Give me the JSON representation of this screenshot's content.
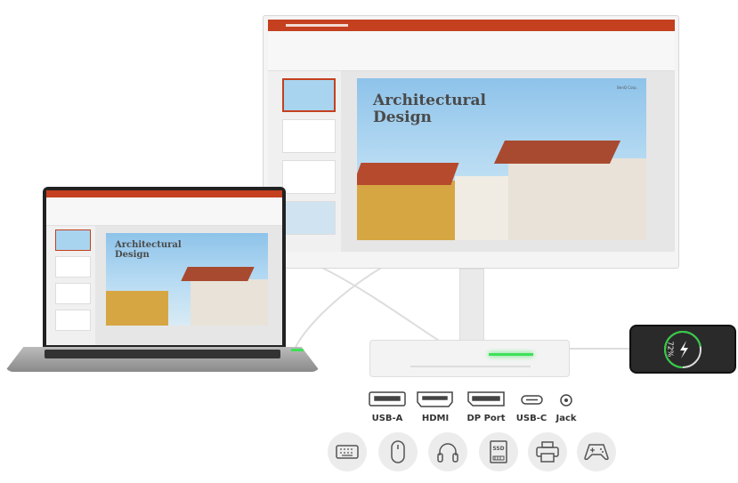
{
  "slide": {
    "title_line1": "Architectural",
    "title_line2": "Design",
    "company": "BenQ Corp."
  },
  "phone": {
    "battery_percent": "72%",
    "battery_level": 0.72,
    "ring_color": "#2ecc40"
  },
  "ports": [
    {
      "label": "USB-A",
      "icon": "usb-a-icon"
    },
    {
      "label": "HDMI",
      "icon": "hdmi-icon"
    },
    {
      "label": "DP Port",
      "icon": "displayport-icon"
    },
    {
      "label": "USB-C",
      "icon": "usb-c-icon"
    },
    {
      "label": "Jack",
      "icon": "audio-jack-icon"
    }
  ],
  "devices": [
    {
      "icon": "keyboard-icon"
    },
    {
      "icon": "mouse-icon"
    },
    {
      "icon": "headphones-icon"
    },
    {
      "icon": "ssd-icon",
      "label": "SSD"
    },
    {
      "icon": "printer-icon"
    },
    {
      "icon": "gamepad-icon"
    }
  ],
  "colors": {
    "powerpoint_red": "#c4401f",
    "led_green": "#3ee05a"
  }
}
